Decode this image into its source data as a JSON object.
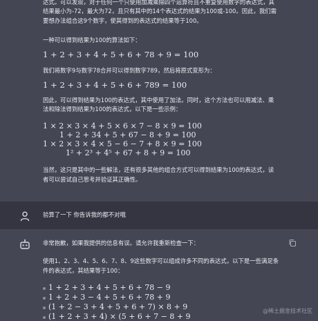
{
  "conversation": {
    "assistant_msg1": {
      "lines": [
        "达式。可以发现，对于任何一个只使用加减乘除四个运算符且不重复使用数字的表达式，其",
        "结果最小为-72，最大为72，且只有其中的14个表达式的结果为100或-100。因此，我们需",
        "要想办法组合这9个数字，使其得到的表达式的结果等于100。"
      ],
      "p2": "一种可以得到结果为100的算法如下：",
      "m1": "1 + 2 + 3 + 4 + 5 + 6 + 78 + 9 = 100",
      "p3": "我们将数字9与数字78合并可以得到数字789，然后将原式变形为：",
      "m2": "1 + 2 + 3 + 4 + 5 + 6 + 789 = 100",
      "p4_lines": [
        "因此，可以得到结果为100的表达式，其中使用了加法。同时，这个方法也可以用减法、乘",
        "法和除法得到结果为100的表达式，以下是一些示例："
      ],
      "examples": [
        "1 × 2 × 3 × 4 + 5 × 6 × 7 − 8 × 9 = 100",
        "1 + 2 + 34 + 5 + 67 − 8 + 9 = 100",
        "1 × 2 × 3 × 4 × 5 − 6 − 7 + 8 × 9 = 100",
        "1² + 2³ + 4⁵ + 67 + 8 + 9 = 100"
      ],
      "p5_lines": [
        "当然，这只是其中的一些解法，还有很多其他的组合方式可以得到结果为100的表达式，读",
        "者可以尝试自己思考并验证其正确性。"
      ]
    },
    "user_msg": {
      "text": "验算了一下 你告诉我的都不对哦"
    },
    "assistant_msg2": {
      "p1": "非常抱歉，如果我提供的信息有误。请允许我重新检查一下：",
      "p2_lines": [
        "使用1、2、3、4、5、6、7、8、9这些数字可以组成许多不同的表达式，以下是一些满足条",
        "件的表达式，其结果等于100："
      ],
      "list": [
        "1 + 2 + 3 + 4 + 5 + 6 + 78 − 9",
        "1 + 2 + 3 − 4 + 5 + 6 + 78 + 9",
        "(1 + 2 − 3 + 4 + 5 + 6 + 7) × 8 + 9",
        "(1 + 2 + 3 + 4) × (5 + 6 + 7 − 8 + 9"
      ]
    }
  },
  "watermark": "@稀土掘金技术社区",
  "icons": {
    "user_avatar": "user-icon",
    "assistant_avatar": "bot-icon",
    "copy": "copy-icon"
  },
  "colors": {
    "assistant_bg": "#444654",
    "user_bg": "#343541",
    "text": "#ececf1",
    "muted": "#8e8ea0"
  }
}
